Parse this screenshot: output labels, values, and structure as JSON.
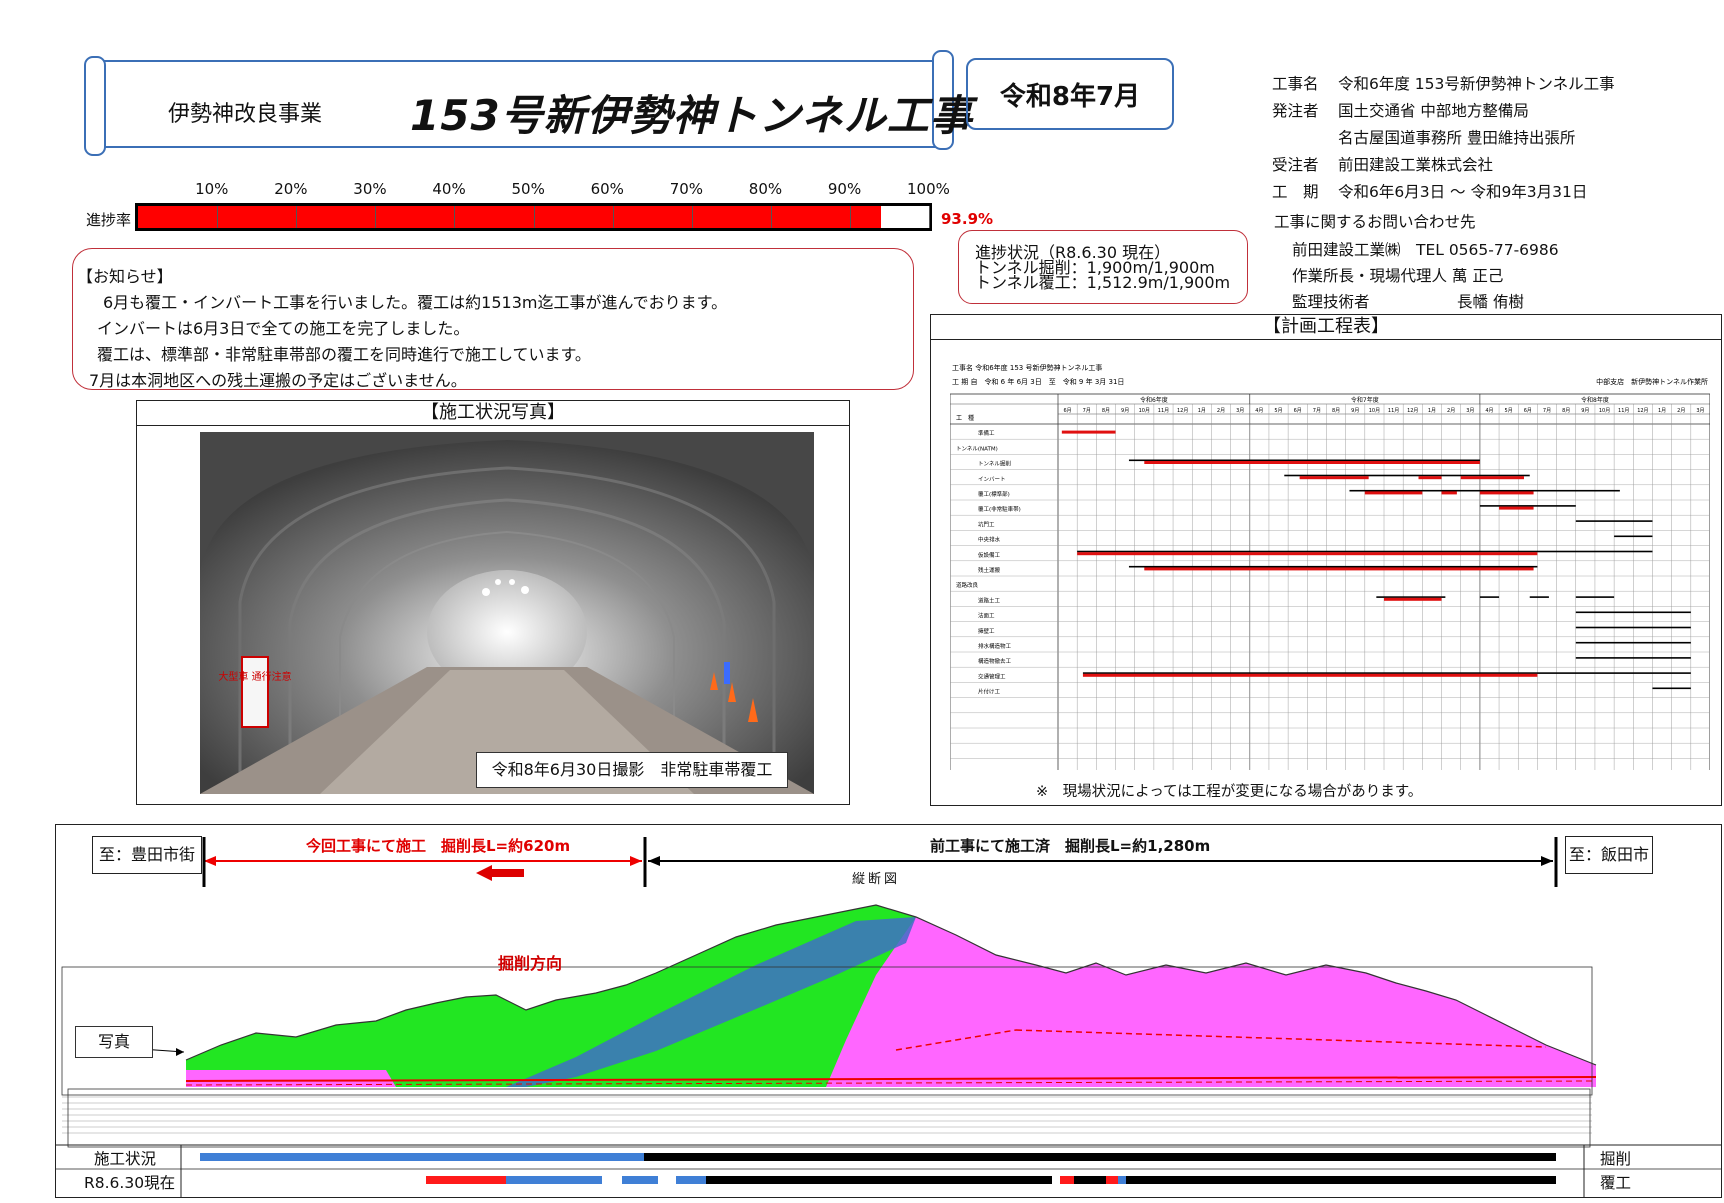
{
  "header": {
    "project_label": "伊勢神改良事業",
    "project_title": "153号新伊勢神トンネル工事",
    "date": "令和8年7月"
  },
  "info": {
    "rows": [
      {
        "key": "工事名",
        "value": "令和6年度 153号新伊勢神トンネル工事"
      },
      {
        "key": "発注者",
        "value": "国土交通省 中部地方整備局"
      },
      {
        "key": "",
        "value": "名古屋国道事務所 豊田維持出張所"
      },
      {
        "key": "受注者",
        "value": "前田建設工業株式会社"
      },
      {
        "key": "工　期",
        "value": "令和6年6月3日 ～ 令和9年3月31日"
      }
    ]
  },
  "contact": {
    "heading": "工事に関するお問い合わせ先",
    "company": "前田建設工業㈱　TEL 0565-77-6986",
    "manager": "作業所長・現場代理人 萬 正己",
    "supervisor_role": "監理技術者",
    "supervisor_name": "長幡 侑樹"
  },
  "progress": {
    "label": "進捗率",
    "value_text": "93.9%",
    "fraction": 0.939,
    "ticks": [
      "10%",
      "20%",
      "30%",
      "40%",
      "50%",
      "60%",
      "70%",
      "80%",
      "90%",
      "100%"
    ],
    "fill_color": "#ff0000"
  },
  "status": {
    "lines": [
      "進捗状況（R8.6.30 現在）",
      "トンネル掘削：1,900m/1,900m",
      "トンネル覆工：1,512.9m/1,900m"
    ]
  },
  "notice": {
    "lines": [
      "【お知らせ】",
      "　6月も覆工・インバート工事を行いました。覆工は約1513m迄工事が進んでおります。",
      "インバートは6月3日で全ての施工を完了しました。",
      "覆工は、標準部・非常駐車帯部の覆工を同時進行で施工しています。",
      "7月は本洞地区への残土運搬の予定はございません。"
    ]
  },
  "photo": {
    "title": "【施工状況写真】",
    "caption": "令和8年6月30日撮影　非常駐車帯覆工",
    "sign_text": "大型車 通行注意"
  },
  "schedule": {
    "title": "【計画工程表】",
    "note": "※　現場状況によっては工程が変更になる場合があります。",
    "doc_line1": "工事名 令和6年度 153 号新伊勢神トンネル工事",
    "doc_line2": "工 期 自　令和 6 年 6月 3日　至　令和 9 年 3月 31日",
    "doc_right": "中部支店　新伊勢神トンネル作業所",
    "header_label": "工　種",
    "years": [
      "令和6年度",
      "令和7年度",
      "令和8年度"
    ],
    "months": [
      "6月",
      "7月",
      "8月",
      "9月",
      "10月",
      "11月",
      "12月",
      "1月",
      "2月",
      "3月",
      "4月",
      "5月",
      "6月",
      "7月",
      "8月",
      "9月",
      "10月",
      "11月",
      "12月",
      "1月",
      "2月",
      "3月",
      "4月",
      "5月",
      "6月",
      "7月",
      "8月",
      "9月",
      "10月",
      "11月",
      "12月",
      "1月",
      "2月",
      "3月"
    ],
    "rows": [
      {
        "name": "準備工",
        "bars": [
          {
            "s": 0.2,
            "e": 3.0,
            "c": "red"
          }
        ]
      },
      {
        "name": "トンネル(NATM)",
        "bars": []
      },
      {
        "name": "トンネル掘削",
        "bars": [
          {
            "s": 3.7,
            "e": 22.0,
            "c": "black"
          },
          {
            "s": 4.5,
            "e": 22.0,
            "c": "red"
          }
        ]
      },
      {
        "name": "インバート",
        "bars": [
          {
            "s": 11.8,
            "e": 24.6,
            "c": "black"
          },
          {
            "s": 12.6,
            "e": 16.2,
            "c": "red"
          },
          {
            "s": 18.8,
            "e": 20.0,
            "c": "red"
          },
          {
            "s": 21.0,
            "e": 24.3,
            "c": "red"
          }
        ]
      },
      {
        "name": "覆工(標準部)",
        "bars": [
          {
            "s": 15.2,
            "e": 29.3,
            "c": "black"
          },
          {
            "s": 16.0,
            "e": 19.0,
            "c": "red"
          },
          {
            "s": 20.0,
            "e": 20.8,
            "c": "red"
          },
          {
            "s": 22.0,
            "e": 24.8,
            "c": "red"
          }
        ]
      },
      {
        "name": "覆工(非常駐車帯)",
        "bars": [
          {
            "s": 22.0,
            "e": 27.0,
            "c": "black"
          },
          {
            "s": 23.0,
            "e": 24.8,
            "c": "red"
          }
        ]
      },
      {
        "name": "坑門工",
        "bars": [
          {
            "s": 27.0,
            "e": 31.0,
            "c": "black"
          }
        ]
      },
      {
        "name": "中央排水",
        "bars": [
          {
            "s": 29.0,
            "e": 31.0,
            "c": "black"
          }
        ]
      },
      {
        "name": "仮設備工",
        "bars": [
          {
            "s": 1.0,
            "e": 31.0,
            "c": "black"
          },
          {
            "s": 1.0,
            "e": 25.0,
            "c": "red"
          }
        ]
      },
      {
        "name": "残土運搬",
        "bars": [
          {
            "s": 3.7,
            "e": 25.0,
            "c": "black"
          },
          {
            "s": 4.5,
            "e": 24.8,
            "c": "red"
          }
        ]
      },
      {
        "name": "道路改良",
        "bars": []
      },
      {
        "name": "道路土工",
        "bars": [
          {
            "s": 16.6,
            "e": 20.2,
            "c": "black"
          },
          {
            "s": 17.0,
            "e": 20.0,
            "c": "red"
          },
          {
            "s": 22.0,
            "e": 23.0,
            "c": "black"
          },
          {
            "s": 24.6,
            "e": 25.6,
            "c": "black"
          },
          {
            "s": 27.0,
            "e": 29.0,
            "c": "black"
          }
        ]
      },
      {
        "name": "法面工",
        "bars": [
          {
            "s": 27.0,
            "e": 33.0,
            "c": "black"
          }
        ]
      },
      {
        "name": "擁壁工",
        "bars": [
          {
            "s": 27.0,
            "e": 33.0,
            "c": "black"
          }
        ]
      },
      {
        "name": "排水構造物工",
        "bars": [
          {
            "s": 27.0,
            "e": 33.0,
            "c": "black"
          }
        ]
      },
      {
        "name": "構造物撤去工",
        "bars": [
          {
            "s": 27.0,
            "e": 33.0,
            "c": "black"
          }
        ]
      },
      {
        "name": "交通管理工",
        "bars": [
          {
            "s": 1.3,
            "e": 33.0,
            "c": "black"
          },
          {
            "s": 1.3,
            "e": 25.0,
            "c": "red"
          }
        ]
      },
      {
        "name": "片付け工",
        "bars": [
          {
            "s": 31.0,
            "e": 33.0,
            "c": "black"
          }
        ]
      },
      {
        "name": "",
        "bars": []
      },
      {
        "name": "",
        "bars": []
      },
      {
        "name": "",
        "bars": []
      },
      {
        "name": "",
        "bars": []
      },
      {
        "name": "",
        "bars": []
      }
    ]
  },
  "profile": {
    "left_end": "至：豊田市街",
    "right_end": "至：飯田市",
    "current_section": "今回工事にて施工　掘削長L=約620m",
    "previous_section": "前工事にて施工済　掘削長L=約1,280m",
    "caption": "縦断図",
    "dig_direction": "掘削方向",
    "photo_marker": "写真",
    "status_label_1": "施工状況",
    "status_label_2": "R8.6.30現在",
    "right_label_1": "掘削",
    "right_label_2": "覆工",
    "colors": {
      "green": "#22e622",
      "magenta": "#ff66ff",
      "blue": "#3f7fd6",
      "red": "#ff1a1a"
    }
  }
}
